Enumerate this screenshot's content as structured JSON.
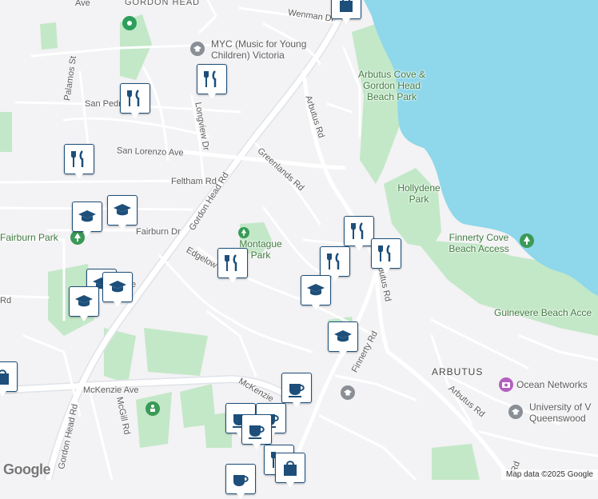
{
  "colors": {
    "water": "#8fd7ea",
    "park": "#c3e8c8",
    "road": "#ffffff",
    "pin_border": "#1d4f7a",
    "pin_icon": "#1d4f7a"
  },
  "streets": {
    "wenman": "Wenman Dr",
    "palamos": "Palamos St",
    "san_pedro": "San Pedro",
    "longview": "Longview Dr",
    "san_lorenzo": "San Lorenzo Ave",
    "feltham": "Feltham Rd",
    "gordon_head_1": "Gordon Head Rd",
    "greenlands": "Greenlands Rd",
    "arbutus_1": "Arbutus Rd",
    "fairburn": "Fairburn Dr",
    "edgelow": "Edgelow St",
    "arbutus_2": "Arbutus Rd",
    "finnerty": "Finnerty Rd",
    "arbutus_3": "Arbutus Rd",
    "mckenzie": "McKenzie Ave",
    "mckenzie_2": "McKenzie",
    "gordon_head_2": "Gordon Head Rd",
    "mcgill": "McGill Rd",
    "top_ave": "Ave",
    "rd_left": "Rd",
    "e_frag": "e",
    "cut_rd": "Rd"
  },
  "places": {
    "gordon_head": "GORDON HEAD",
    "myc": "MYC (Music for Young Children) Victoria",
    "myc_line1": "MYC (Music for Young",
    "myc_line2": "Children) Victoria",
    "arbutus_cove_1": "Arbutus Cove &",
    "arbutus_cove_2": "Gordon Head",
    "arbutus_cove_3": "Beach Park",
    "hollydene_1": "Hollydene",
    "hollydene_2": "Park",
    "fairburn_park": "Fairburn Park",
    "montague_1": "Montague",
    "montague_2": "Park",
    "finnerty_cove_1": "Finnerty Cove",
    "finnerty_cove_2": "Beach Access",
    "guinevere": "Guinevere Beach Acce",
    "arbutus_area": "ARBUTUS",
    "ocean_networks": "Ocean Networks",
    "uvic_1": "University of V",
    "uvic_2": "Queenswood"
  },
  "attribution": "Map data ©2025 Google",
  "google_logo": "Google",
  "icons": {
    "restaurant": "restaurant-icon",
    "school": "school-icon",
    "cafe": "cafe-icon",
    "shopping": "shopping-bag-icon"
  }
}
